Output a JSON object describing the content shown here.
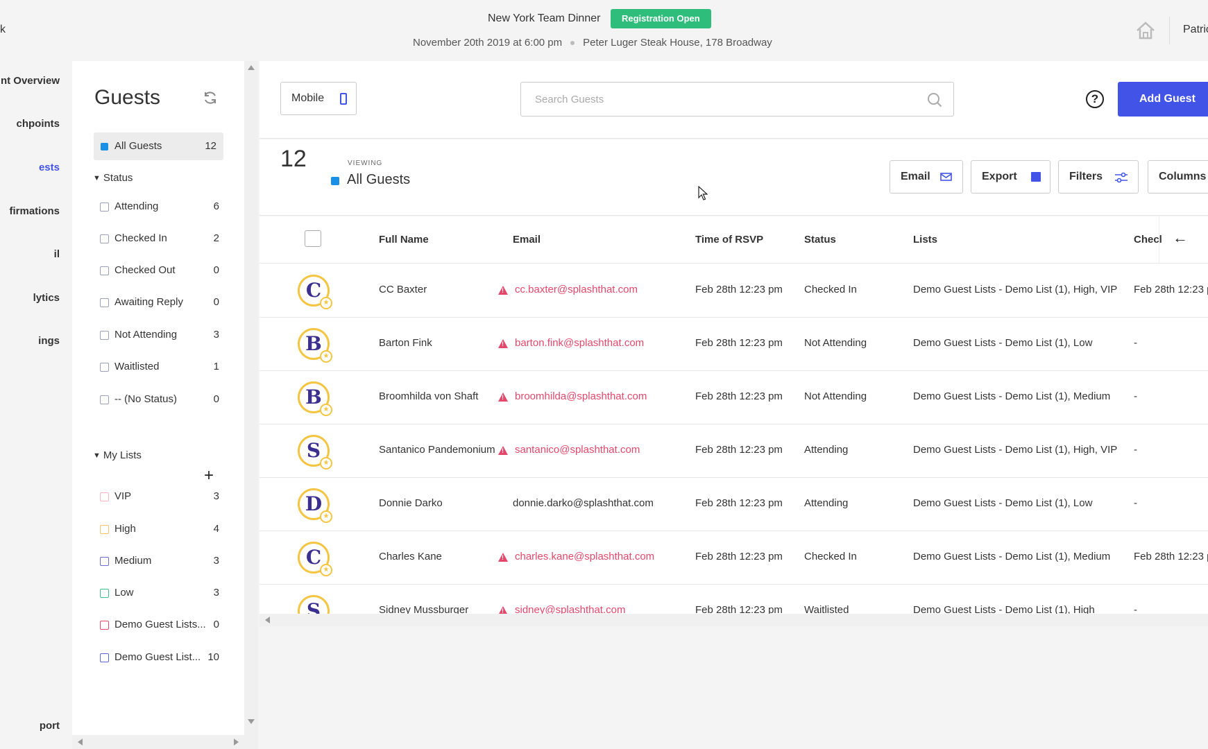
{
  "header": {
    "event_title": "New York Team Dinner",
    "registration_badge": "Registration Open",
    "event_date": "November 20th 2019 at 6:00 pm",
    "event_location": "Peter Luger Steak House, 178 Broadway",
    "user_name": "Patric",
    "left_cut_text": "k"
  },
  "leftnav": {
    "items": [
      {
        "label": "nt Overview",
        "active": false
      },
      {
        "label": "chpoints",
        "active": false
      },
      {
        "label": "ests",
        "active": true
      },
      {
        "label": "firmations",
        "active": false
      },
      {
        "label": "il",
        "active": false
      },
      {
        "label": "lytics",
        "active": false
      },
      {
        "label": "ings",
        "active": false
      },
      {
        "label": "port",
        "active": false
      }
    ]
  },
  "sidebar": {
    "title": "Guests",
    "all_guests": {
      "label": "All Guests",
      "count": "12"
    },
    "status_header": "Status",
    "status_items": [
      {
        "label": "Attending",
        "count": "6"
      },
      {
        "label": "Checked In",
        "count": "2"
      },
      {
        "label": "Checked Out",
        "count": "0"
      },
      {
        "label": "Awaiting Reply",
        "count": "0"
      },
      {
        "label": "Not Attending",
        "count": "3"
      },
      {
        "label": "Waitlisted",
        "count": "1"
      },
      {
        "label": "-- (No Status)",
        "count": "0"
      }
    ],
    "lists_header": "My Lists",
    "list_items": [
      {
        "label": "VIP",
        "count": "3",
        "color": "#f5b5c5"
      },
      {
        "label": "High",
        "count": "4",
        "color": "#f5c36b"
      },
      {
        "label": "Medium",
        "count": "3",
        "color": "#6b6bd6"
      },
      {
        "label": "Low",
        "count": "3",
        "color": "#3fbf8a"
      },
      {
        "label": "Demo Guest Lists...",
        "count": "0",
        "color": "#e5476b"
      },
      {
        "label": "Demo Guest List...",
        "count": "10",
        "color": "#5a6ad0"
      }
    ]
  },
  "toolbar": {
    "mobile_label": "Mobile",
    "search_placeholder": "Search Guests",
    "help_label": "?",
    "add_guest_label": "Add Guest"
  },
  "viewbar": {
    "count": "12",
    "viewing_label": "VIEWING",
    "viewing_name": "All Guests",
    "email_label": "Email",
    "export_label": "Export",
    "filters_label": "Filters",
    "columns_label": "Columns"
  },
  "table": {
    "headers": {
      "full_name": "Full Name",
      "email": "Email",
      "time_of_rsvp": "Time of RSVP",
      "status": "Status",
      "lists": "Lists",
      "check": "Checl"
    },
    "rows": [
      {
        "glyph": "C",
        "name": "CC Baxter",
        "email": "cc.baxter@splashthat.com",
        "email_warning": true,
        "rsvp": "Feb 28th 12:23 pm",
        "status": "Checked In",
        "lists": "Demo Guest Lists - Demo List (1), High, VIP",
        "check": "Feb 28th 12:23 p"
      },
      {
        "glyph": "B",
        "name": "Barton Fink",
        "email": "barton.fink@splashthat.com",
        "email_warning": true,
        "rsvp": "Feb 28th 12:23 pm",
        "status": "Not Attending",
        "lists": "Demo Guest Lists - Demo List (1), Low",
        "check": "-"
      },
      {
        "glyph": "B",
        "name": "Broomhilda von Shaft",
        "email": "broomhilda@splashthat.com",
        "email_warning": true,
        "rsvp": "Feb 28th 12:23 pm",
        "status": "Not Attending",
        "lists": "Demo Guest Lists - Demo List (1), Medium",
        "check": "-"
      },
      {
        "glyph": "S",
        "name": "Santanico Pandemonium",
        "email": "santanico@splashthat.com",
        "email_warning": true,
        "rsvp": "Feb 28th 12:23 pm",
        "status": "Attending",
        "lists": "Demo Guest Lists - Demo List (1), High, VIP",
        "check": "-"
      },
      {
        "glyph": "D",
        "name": "Donnie Darko",
        "email": "donnie.darko@splashthat.com",
        "email_warning": false,
        "rsvp": "Feb 28th 12:23 pm",
        "status": "Attending",
        "lists": "Demo Guest Lists - Demo List (1), Low",
        "check": "-"
      },
      {
        "glyph": "C",
        "name": "Charles Kane",
        "email": "charles.kane@splashthat.com",
        "email_warning": true,
        "rsvp": "Feb 28th 12:23 pm",
        "status": "Checked In",
        "lists": "Demo Guest Lists - Demo List (1), Medium",
        "check": "Feb 28th 12:23 p"
      },
      {
        "glyph": "S",
        "name": "Sidney Mussburger",
        "email": "sidney@splashthat.com",
        "email_warning": true,
        "rsvp": "Feb 28th 12:23 pm",
        "status": "Waitlisted",
        "lists": "Demo Guest Lists - Demo List (1), High",
        "check": "-"
      }
    ]
  },
  "colors": {
    "accent": "#4254e8",
    "badge_green": "#2ebd7a",
    "warning": "#e5476b",
    "all_guests_blue": "#1a8fe6",
    "avatar_ring": "#f4c542"
  }
}
